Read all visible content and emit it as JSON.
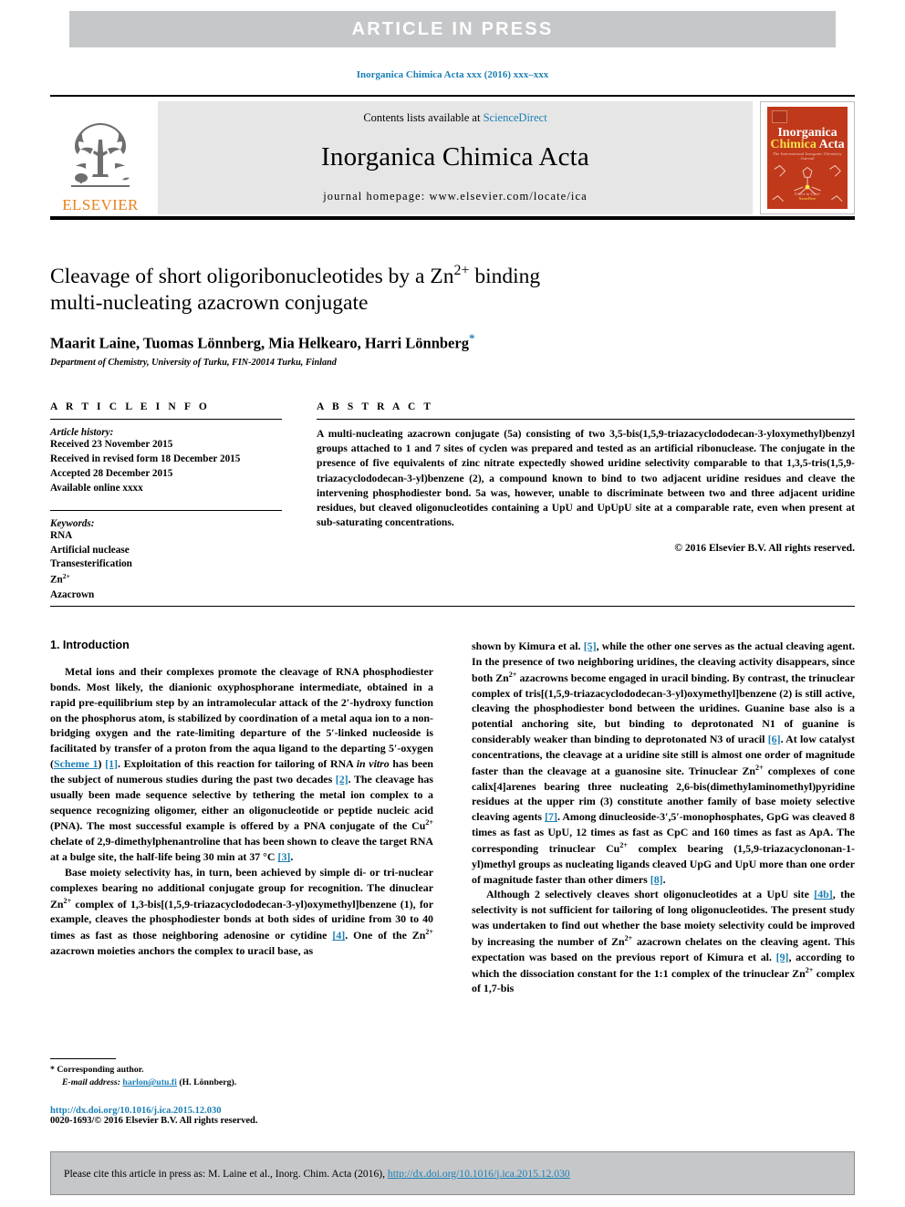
{
  "banner": {
    "text": "ARTICLE  IN  PRESS"
  },
  "running_head": {
    "text": "Inorganica Chimica Acta xxx (2016) xxx–xxx"
  },
  "masthead": {
    "contents_prefix": "Contents lists available at ",
    "sciencedirect_link": "ScienceDirect",
    "journal_name": "Inorganica Chimica Acta",
    "homepage": "journal homepage: www.elsevier.com/locate/ica",
    "publisher_wordmark": "ELSEVIER",
    "cover": {
      "line1": "Inorganica",
      "line2_a": "Chimica",
      "line2_b": "Acta",
      "subtitle": "The International Inorganic Chemistry Journal",
      "foot_top": "Editor-in-Chief",
      "foot_bottom": "NameHere"
    }
  },
  "article": {
    "title_line1": "Cleavage of short oligoribonucleotides by a Zn",
    "title_sup": "2+",
    "title_line1_tail": " binding",
    "title_line2": "multi-nucleating azacrown conjugate",
    "authors": "Maarit Laine, Tuomas Lönnberg, Mia Helkearo, Harri Lönnberg",
    "corresponding_marker": "*",
    "affiliation": "Department of Chemistry, University of Turku, FIN-20014 Turku, Finland"
  },
  "info": {
    "heading": "A R T I C L E   I N F O",
    "history_label": "Article history:",
    "history": [
      "Received 23 November 2015",
      "Received in revised form 18 December 2015",
      "Accepted 28 December 2015",
      "Available online xxxx"
    ],
    "keywords_label": "Keywords:",
    "keywords": [
      "RNA",
      "Artificial nuclease",
      "Transesterification",
      "Zn2+",
      "Azacrown"
    ],
    "keyword_zn_base": "Zn",
    "keyword_zn_sup": "2+"
  },
  "abstract": {
    "heading": "A B S T R A C T",
    "paragraph_a": "A multi-nucleating azacrown conjugate (",
    "bold_5a": "5a",
    "paragraph_b": ") consisting of two 3,5-bis(1,5,9-triazacyclododecan-3-yloxymethyl)benzyl groups attached to 1 and 7 sites of cyclen was prepared and tested as an artificial ribonuclease. The conjugate in the presence of five equivalents of zinc nitrate expectedly showed uridine selectivity comparable to that 1,3,5-tris(1,5,9-triazacyclododecan-3-yl)benzene (",
    "bold_2": "2",
    "paragraph_c": "), a compound known to bind to two adjacent uridine residues and cleave the intervening phosphodiester bond. ",
    "bold_5a_2": "5a",
    "paragraph_d": " was, however, unable to discriminate between two and three adjacent uridine residues, but cleaved oligonucleotides containing a UpU and UpUpU site at a comparable rate, even when present at sub-saturating concentrations.",
    "copyright": "© 2016 Elsevier B.V. All rights reserved."
  },
  "body": {
    "section_title": "1. Introduction",
    "left": {
      "p1_a": "Metal ions and their complexes promote the cleavage of RNA phosphodiester bonds. Most likely, the dianionic oxyphosphorane intermediate, obtained in a rapid pre-equilibrium step by an intramolecular attack of the 2",
      "p1_prime1": "′",
      "p1_b": "-hydroxy function on the phosphorus atom, is stabilized by coordination of a metal aqua ion to a non-bridging oxygen and the rate-limiting departure of the 5",
      "p1_prime2": "′",
      "p1_c": "-linked nucleoside is facilitated by transfer of a proton from the aqua ligand to the departing 5",
      "p1_prime3": "′",
      "p1_d": "-oxygen (",
      "p1_scheme": "Scheme 1",
      "p1_e": ") ",
      "p1_ref1": "[1]",
      "p1_f": ". Exploitation of this reaction for tailoring of RNA ",
      "p1_invitro": "in vitro",
      "p1_g": " has been the subject of numerous studies during the past two decades ",
      "p1_ref2": "[2]",
      "p1_h": ". The cleavage has usually been made sequence selective by tethering the metal ion complex to a sequence recognizing oligomer, either an oligonucleotide or peptide nucleic acid (PNA). The most successful example is offered by a PNA conjugate of the Cu",
      "p1_sup1": "2+",
      "p1_i": " chelate of 2,9-dimethylphenantroline that has been shown to cleave the target RNA at a bulge site, the half-life being 30 min at 37 °C ",
      "p1_ref3": "[3]",
      "p1_j": ".",
      "p2_a": "Base moiety selectivity has, in turn, been achieved by simple di- or tri-nuclear complexes bearing no additional conjugate group for recognition. The dinuclear Zn",
      "p2_sup1": "2+",
      "p2_b": " complex of 1,3-bis[(1,5,9-triazacyclododecan-3-yl)oxymethyl]benzene (",
      "p2_bold1": "1",
      "p2_c": "), for example, cleaves the phosphodiester bonds at both sides of uridine from 30 to 40 times as fast as those neighboring adenosine or cytidine ",
      "p2_ref4": "[4]",
      "p2_d": ". One of the Zn",
      "p2_sup2": "2+",
      "p2_e": " azacrown moieties anchors the complex to uracil base, as"
    },
    "right": {
      "p3_a": "shown by Kimura et al. ",
      "p3_ref5": "[5]",
      "p3_b": ", while the other one serves as the actual cleaving agent. In the presence of two neighboring uridines, the cleaving activity disappears, since both Zn",
      "p3_sup1": "2+",
      "p3_c": " azacrowns become engaged in uracil binding. By contrast, the trinuclear complex of tris[(1,5,9-triazacyclododecan-3-yl)oxymethyl]benzene (",
      "p3_bold2": "2",
      "p3_d": ") is still active, cleaving the phosphodiester bond between the uridines. Guanine base also is a potential anchoring site, but binding to deprotonated N1 of guanine is considerably weaker than binding to deprotonated N3 of uracil ",
      "p3_ref6": "[6]",
      "p3_e": ". At low catalyst concentrations, the cleavage at a uridine site still is almost one order of magnitude faster than the cleavage at a guanosine site. Trinuclear Zn",
      "p3_sup2": "2+",
      "p3_f": " complexes of cone calix[4]arenes bearing three nucleating 2,6-bis(dimethylaminomethyl)pyridine residues at the upper rim (",
      "p3_bold3": "3",
      "p3_g": ") constitute another family of base moiety selective cleaving agents ",
      "p3_ref7": "[7]",
      "p3_h": ". Among dinucleoside-3",
      "p3_prime1": "′",
      "p3_i": ",5",
      "p3_prime2": "′",
      "p3_j": "-monophosphates, GpG was cleaved 8 times as fast as UpU, 12 times as fast as CpC and 160 times as fast as ApA. The corresponding trinuclear Cu",
      "p3_sup3": "2+",
      "p3_k": " complex bearing (1,5,9-triazacyclononan-1-yl)methyl groups as nucleating ligands cleaved UpG and UpU more than one order of magnitude faster than other dimers ",
      "p3_ref8": "[8]",
      "p3_l": ".",
      "p4_a": "Although ",
      "p4_bold2": "2",
      "p4_b": " selectively cleaves short oligonucleotides at a UpU site ",
      "p4_ref4b": "[4b]",
      "p4_c": ", the selectivity is not sufficient for tailoring of long oligonucleotides. The present study was undertaken to find out whether the base moiety selectivity could be improved by increasing the number of Zn",
      "p4_sup1": "2+",
      "p4_d": " azacrown chelates on the cleaving agent. This expectation was based on the previous report of Kimura et al. ",
      "p4_ref9": "[9]",
      "p4_e": ", according to which the dissociation constant for the 1:1 complex of the trinuclear Zn",
      "p4_sup2": "2+",
      "p4_f": " complex of 1,7-bis"
    }
  },
  "footnote": {
    "star": "*",
    "corresponding": "Corresponding author.",
    "email_label": "E-mail address:",
    "email": "harlon@utu.fi",
    "email_owner": "(H. Lönnberg).",
    "doi": "http://dx.doi.org/10.1016/j.ica.2015.12.030",
    "issn_copyright": "0020-1693/© 2016 Elsevier B.V. All rights reserved."
  },
  "cite_bar": {
    "prefix": "Please cite this article in press as: M. Laine et al., Inorg. Chim. Acta (2016), ",
    "link": "http://dx.doi.org/10.1016/j.ica.2015.12.030"
  },
  "colors": {
    "banner_gray": "#c6c7c9",
    "link_blue": "#1b7fb5",
    "elsevier_orange": "#e8821a",
    "cover_red": "#c0391b",
    "masthead_gray": "#e6e6e6"
  }
}
